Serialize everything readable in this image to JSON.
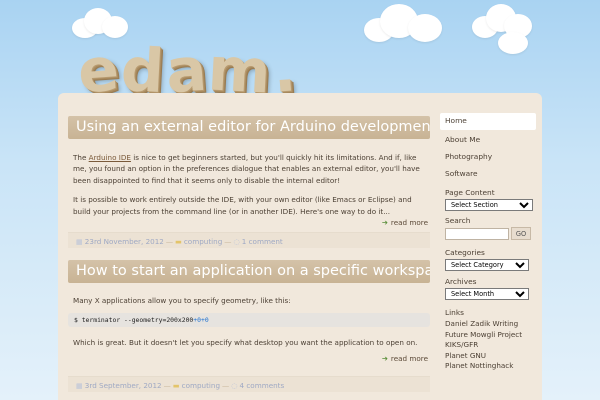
{
  "site": {
    "logo_letters": [
      "e",
      "d",
      "a",
      "m",
      "."
    ]
  },
  "posts": [
    {
      "title": "Using an external editor for Arduino development",
      "body_link": "Arduino IDE",
      "body_p1_after_link": " is nice to get beginners started, but you'll quickly hit its limitations. And if, like me, you found an option in the preferences dialogue that enables an external editor, you'll have been disappointed to find that it seems only to disable the internal editor!",
      "body_p1_prefix": "The ",
      "body_p2": "It is possible to work entirely outside the IDE, with your own editor (like Emacs or Eclipse) and build your projects from the command line (or in another IDE). Here's one way to do it...",
      "read_more": "read more",
      "date": "23rd November, 2012",
      "category": "computing",
      "comments": "1 comment"
    },
    {
      "title": "How to start an application on a specific workspace",
      "body_p1": "Many X applications allow you to specify geometry, like this:",
      "code_prefix": "$ terminator --geometry=200x200",
      "code_p1": "+0",
      "code_p2": "+0",
      "body_p2": "Which is great. But it doesn't let you specify what desktop you want the application to open on.",
      "read_more": "read more",
      "date": "3rd September, 2012",
      "category": "computing",
      "comments": "4 comments"
    }
  ],
  "sidebar": {
    "nav": [
      "Home",
      "About Me",
      "Photography",
      "Software"
    ],
    "page_content_title": "Page Content",
    "page_content_selected": "Select Section",
    "search_title": "Search",
    "search_value": "",
    "go_label": "GO",
    "categories_title": "Categories",
    "categories_selected": "Select Category",
    "archives_title": "Archives",
    "archives_selected": "Select Month",
    "links_title": "Links",
    "links": [
      "Daniel Zadik Writing",
      "Future Mowgli Project",
      "KIKS/GFR",
      "Planet GNU",
      "Planet Nottinghack"
    ]
  }
}
